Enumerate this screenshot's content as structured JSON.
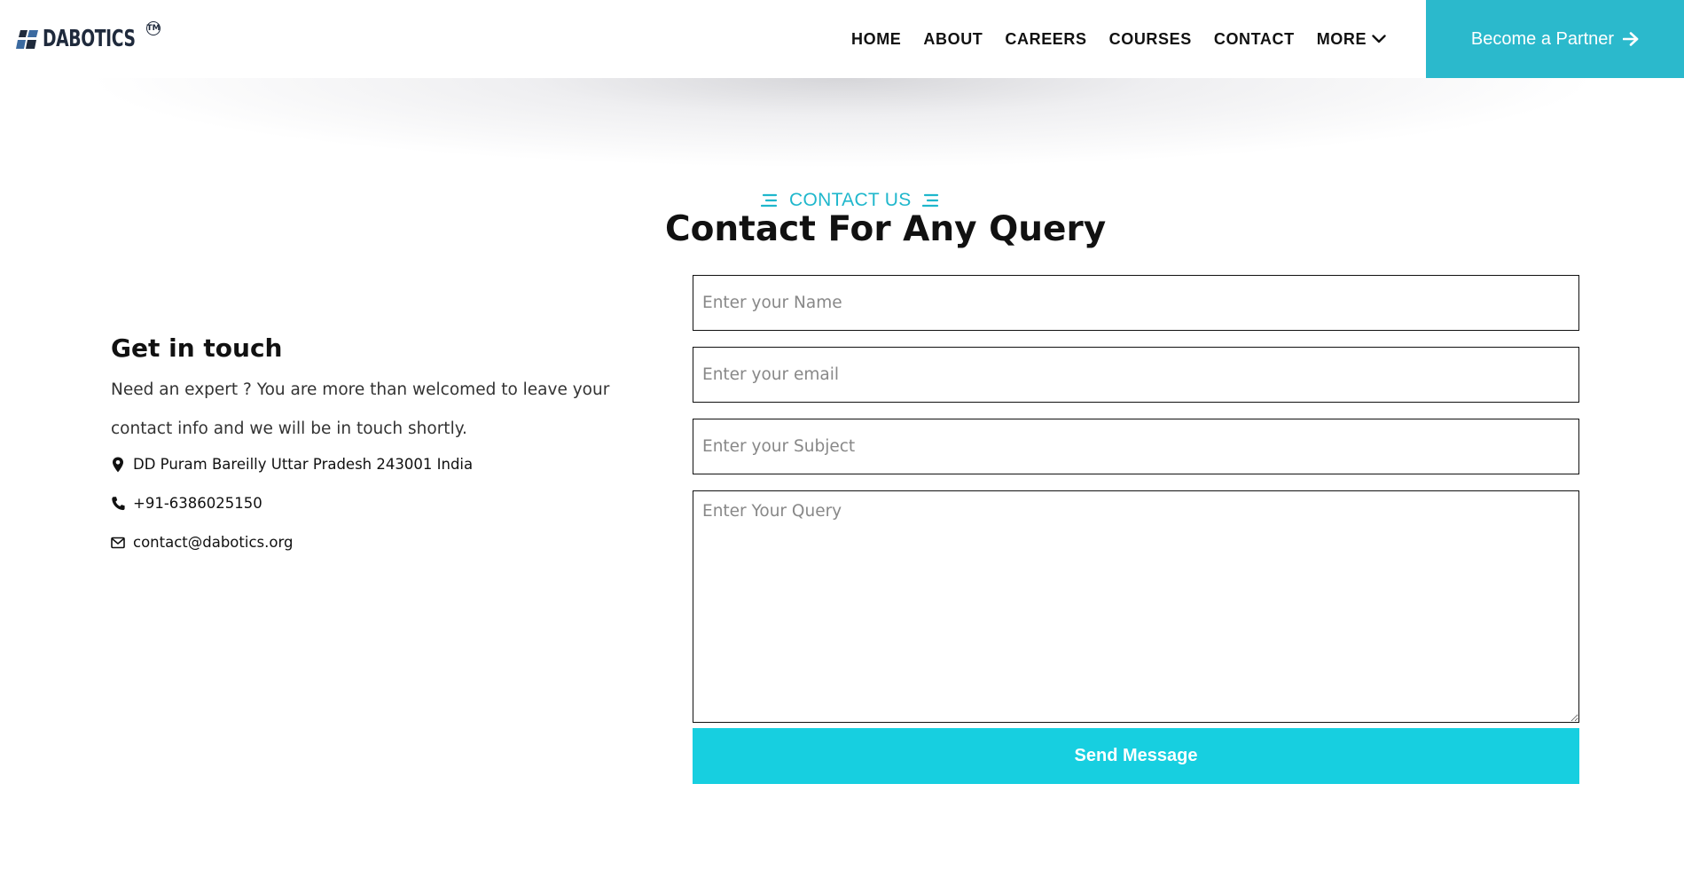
{
  "brand": {
    "name": "DABOTICS",
    "trademark": "TM"
  },
  "nav": {
    "items": [
      {
        "label": "HOME"
      },
      {
        "label": "ABOUT"
      },
      {
        "label": "CAREERS"
      },
      {
        "label": "COURSES"
      },
      {
        "label": "CONTACT"
      },
      {
        "label": "MORE"
      }
    ],
    "cta_label": "Become a Partner"
  },
  "section": {
    "eyebrow": "CONTACT US",
    "title": "Contact For Any Query"
  },
  "info": {
    "title": "Get in touch",
    "description": "Need an expert ? You are more than welcomed to leave your contact info and we will be in touch shortly.",
    "address": "DD Puram Bareilly Uttar Pradesh 243001 India",
    "phone": "+91-6386025150",
    "email": "contact@dabotics.org"
  },
  "form": {
    "name_placeholder": "Enter your Name",
    "email_placeholder": "Enter your email",
    "subject_placeholder": "Enter your Subject",
    "query_placeholder": "Enter Your Query",
    "submit_label": "Send Message"
  },
  "colors": {
    "accent": "#2bb9cc",
    "submit": "#17cfe0",
    "eyebrow": "#1fb7cc",
    "logo": "#1f2a3c"
  }
}
